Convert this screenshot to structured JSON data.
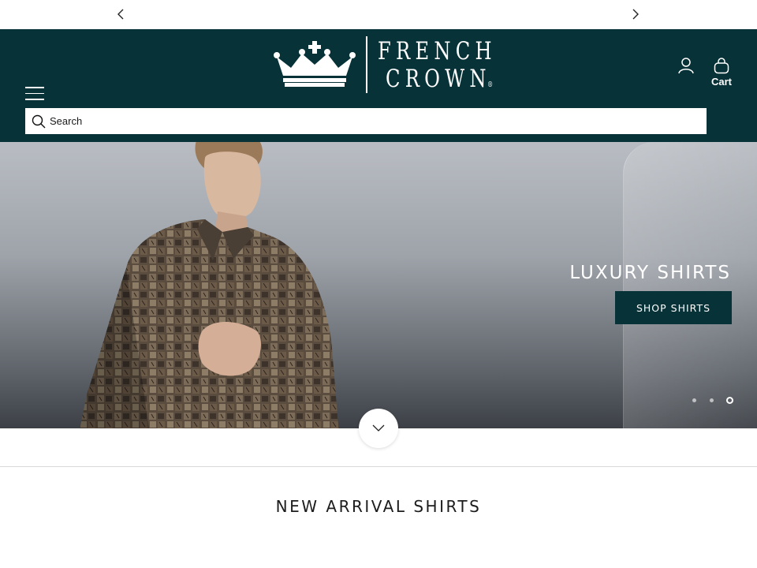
{
  "announcement": {
    "prev_icon": "chevron-left-icon",
    "next_icon": "chevron-right-icon"
  },
  "header": {
    "menu_icon": "hamburger-menu-icon",
    "brand": {
      "line1": "FRENCH",
      "line2": "CROWN",
      "reg": "®",
      "logo_icon": "crown-icon"
    },
    "account_icon": "user-icon",
    "cart_label": "Cart",
    "cart_icon": "shopping-bag-icon"
  },
  "search": {
    "placeholder": "Search",
    "icon": "search-icon"
  },
  "hero": {
    "title": "LUXURY SHIRTS",
    "button_label": "SHOP SHIRTS",
    "slides_total": 3,
    "active_slide": 3
  },
  "scroll_down_icon": "chevron-down-icon",
  "section": {
    "title": "NEW ARRIVAL SHIRTS"
  },
  "colors": {
    "brand": "#063238",
    "white": "#ffffff"
  }
}
